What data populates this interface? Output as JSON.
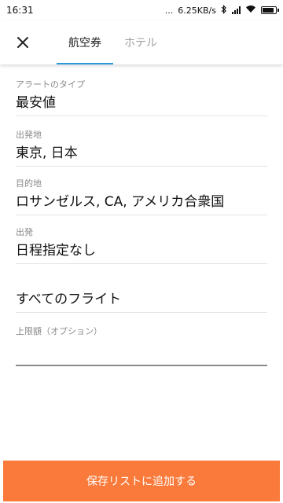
{
  "status_bar": {
    "time": "16:31",
    "dots": "...",
    "speed": "6.25KB/s",
    "icons": [
      "bluetooth-icon",
      "signal-icon",
      "wifi-icon",
      "battery-icon"
    ]
  },
  "header": {
    "close_icon": "close-icon",
    "tabs": [
      {
        "label": "航空券",
        "active": true
      },
      {
        "label": "ホテル",
        "active": false
      }
    ],
    "accent_color": "#2a9ad8"
  },
  "form": {
    "alert_type": {
      "label": "アラートのタイプ",
      "value": "最安値"
    },
    "origin": {
      "label": "出発地",
      "value": "東京, 日本"
    },
    "destination": {
      "label": "目的地",
      "value": "ロサンゼルス, CA, アメリカ合衆国"
    },
    "departure": {
      "label": "出発",
      "value": "日程指定なし"
    },
    "flights": {
      "value": "すべてのフライト"
    },
    "max_price": {
      "placeholder": "上限額（オプション）",
      "value": ""
    }
  },
  "footer": {
    "save_label": "保存リストに追加する",
    "button_color": "#f97a3a"
  }
}
